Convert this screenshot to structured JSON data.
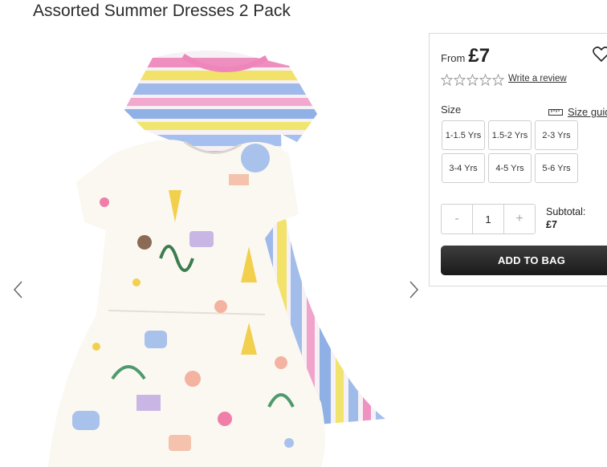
{
  "product": {
    "title": "Assorted Summer Dresses 2 Pack"
  },
  "pricing": {
    "from_label": "From",
    "price": "£7"
  },
  "rating": {
    "stars": 0,
    "max": 5,
    "review_link": "Write a review"
  },
  "size": {
    "label": "Size",
    "guide_label": "Size guide",
    "options": [
      "1-1.5 Yrs",
      "1.5-2 Yrs",
      "2-3 Yrs",
      "3-4 Yrs",
      "4-5 Yrs",
      "5-6 Yrs"
    ]
  },
  "quantity": {
    "minus": "-",
    "value": "1",
    "plus": "+"
  },
  "subtotal": {
    "label": "Subtotal:",
    "amount": "£7"
  },
  "cart": {
    "add_label": "ADD TO BAG"
  },
  "icons": {
    "prev": "chevron-left-icon",
    "next": "chevron-right-icon",
    "wishlist": "heart-icon",
    "ruler": "ruler-icon"
  },
  "colors": {
    "button_dark": "#222222",
    "border": "#d9d9d9"
  }
}
